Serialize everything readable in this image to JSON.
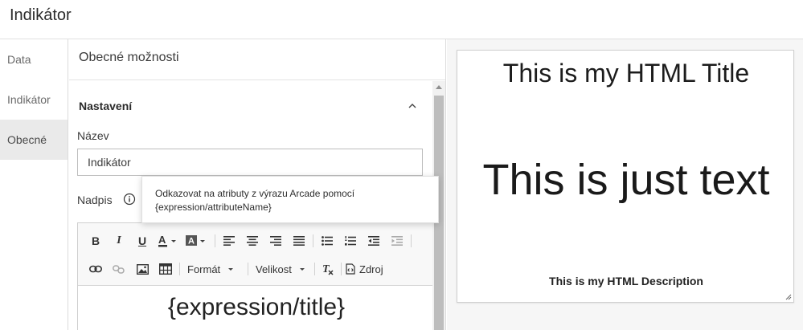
{
  "app": {
    "title": "Indikátor"
  },
  "nav": {
    "items": [
      {
        "label": "Data"
      },
      {
        "label": "Indikátor"
      },
      {
        "label": "Obecné"
      }
    ]
  },
  "panel": {
    "header": "Obecné možnosti",
    "section_title": "Nastavení",
    "name_label": "Název",
    "name_value": "Indikátor",
    "caption_label": "Nadpis"
  },
  "tooltip": {
    "line1": "Odkazovat na atributy z výrazu Arcade pomocí",
    "line2": "{expression/attributeName}"
  },
  "editor": {
    "format_label": "Formát",
    "size_label": "Velikost",
    "source_label": "Zdroj",
    "content": "{expression/title}"
  },
  "preview": {
    "title": "This is my HTML Title",
    "text": "This is just text",
    "description": "This is my HTML Description"
  }
}
